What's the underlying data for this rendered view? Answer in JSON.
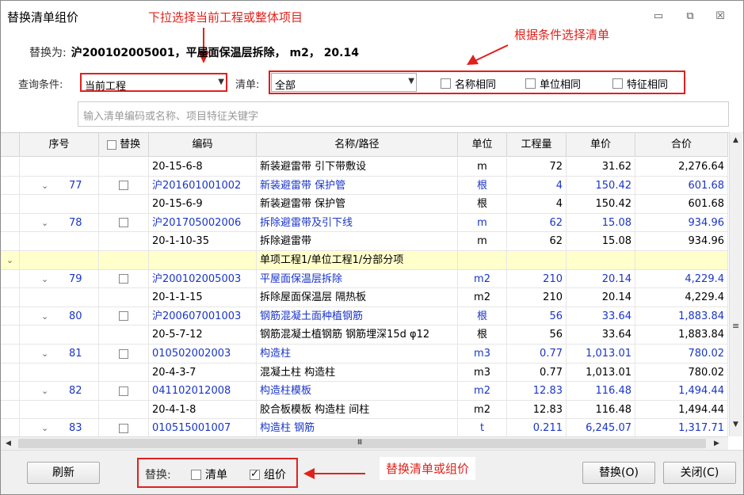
{
  "window": {
    "title": "替换清单组价",
    "minimize_glyph": "▭",
    "restore_glyph": "⧉",
    "close_glyph": "☒"
  },
  "annotations": {
    "top": "下拉选择当前工程或整体项目",
    "right": "根据条件选择清单",
    "bottom": "替换清单或组价",
    "color": "#e0221c"
  },
  "replace_info": {
    "label": "替换为:",
    "value": "沪200102005001，平屋面保温层拆除， m2， 20.14"
  },
  "query": {
    "label": "查询条件:",
    "scope_value": "当前工程",
    "list_label": "清单:",
    "list_value": "全部",
    "checks": [
      {
        "label": "名称相同",
        "checked": false
      },
      {
        "label": "单位相同",
        "checked": false
      },
      {
        "label": "特征相同",
        "checked": false
      }
    ]
  },
  "search": {
    "placeholder": "输入清单编码或名称、项目特征关键字"
  },
  "table": {
    "headers": [
      "序号",
      "替换",
      "编码",
      "名称/路径",
      "单位",
      "工程量",
      "单价",
      "合价"
    ],
    "rows": [
      {
        "kind": "sub",
        "seq": "",
        "code": "20-15-6-8",
        "name": "新装避雷带 引下带敷设",
        "unit": "m",
        "qty": "72",
        "price": "31.62",
        "total": "2,276.64"
      },
      {
        "kind": "item",
        "seq": "77",
        "code": "沪201601001002",
        "name": "新装避雷带 保护管",
        "unit": "根",
        "qty": "4",
        "price": "150.42",
        "total": "601.68"
      },
      {
        "kind": "sub",
        "seq": "",
        "code": "20-15-6-9",
        "name": "新装避雷带 保护管",
        "unit": "根",
        "qty": "4",
        "price": "150.42",
        "total": "601.68"
      },
      {
        "kind": "item",
        "seq": "78",
        "code": "沪201705002006",
        "name": "拆除避雷带及引下线",
        "unit": "m",
        "qty": "62",
        "price": "15.08",
        "total": "934.96"
      },
      {
        "kind": "sub",
        "seq": "",
        "code": "20-1-10-35",
        "name": "拆除避雷带",
        "unit": "m",
        "qty": "62",
        "price": "15.08",
        "total": "934.96"
      },
      {
        "kind": "group",
        "seq": "",
        "code": "",
        "name": "单项工程1/单位工程1/分部分项",
        "unit": "",
        "qty": "",
        "price": "",
        "total": ""
      },
      {
        "kind": "item",
        "seq": "79",
        "code": "沪200102005003",
        "name": "平屋面保温层拆除",
        "unit": "m2",
        "qty": "210",
        "price": "20.14",
        "total": "4,229.4"
      },
      {
        "kind": "sub",
        "seq": "",
        "code": "20-1-1-15",
        "name": "拆除屋面保温层 隔热板",
        "unit": "m2",
        "qty": "210",
        "price": "20.14",
        "total": "4,229.4"
      },
      {
        "kind": "item",
        "seq": "80",
        "code": "沪200607001003",
        "name": "钢筋混凝土面种植钢筋",
        "unit": "根",
        "qty": "56",
        "price": "33.64",
        "total": "1,883.84"
      },
      {
        "kind": "sub",
        "seq": "",
        "code": "20-5-7-12",
        "name": "钢筋混凝土植钢筋 钢筋埋深15d φ12",
        "unit": "根",
        "qty": "56",
        "price": "33.64",
        "total": "1,883.84"
      },
      {
        "kind": "item",
        "seq": "81",
        "code": "010502002003",
        "name": "构造柱",
        "unit": "m3",
        "qty": "0.77",
        "price": "1,013.01",
        "total": "780.02"
      },
      {
        "kind": "sub",
        "seq": "",
        "code": "20-4-3-7",
        "name": "混凝土柱 构造柱",
        "unit": "m3",
        "qty": "0.77",
        "price": "1,013.01",
        "total": "780.02"
      },
      {
        "kind": "item",
        "seq": "82",
        "code": "041102012008",
        "name": "构造柱模板",
        "unit": "m2",
        "qty": "12.83",
        "price": "116.48",
        "total": "1,494.44"
      },
      {
        "kind": "sub",
        "seq": "",
        "code": "20-4-1-8",
        "name": "胶合板模板 构造柱 间柱",
        "unit": "m2",
        "qty": "12.83",
        "price": "116.48",
        "total": "1,494.44"
      },
      {
        "kind": "item",
        "seq": "83",
        "code": "010515001007",
        "name": "构造柱 钢筋",
        "unit": "t",
        "qty": "0.211",
        "price": "6,245.07",
        "total": "1,317.71"
      }
    ]
  },
  "footer": {
    "refresh": "刷新",
    "replace_label": "替换:",
    "opt_list": "清单",
    "opt_list_checked": false,
    "opt_price": "组价",
    "opt_price_checked": true,
    "replace_btn": "替换(O)",
    "close_btn": "关闭(C)"
  },
  "scroll": {
    "grip": "Ⅲ",
    "up": "▲",
    "down": "▼",
    "left": "◀",
    "right": "▶",
    "side_grip": "≡"
  }
}
